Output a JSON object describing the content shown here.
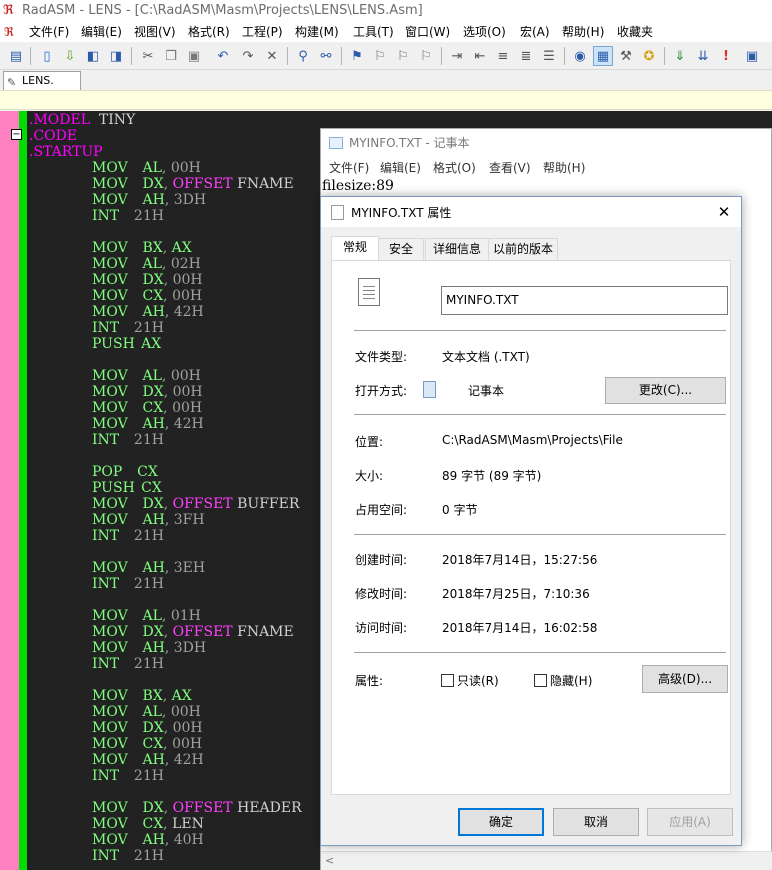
{
  "app": {
    "title": "RadASM - LENS - [C:\\RadASM\\Masm\\Projects\\LENS\\LENS.Asm]",
    "menu": [
      "文件(F)",
      "编辑(E)",
      "视图(V)",
      "格式(R)",
      "工程(P)",
      "构建(M)",
      "工具(T)",
      "窗口(W)",
      "选项(O)",
      "宏(A)",
      "帮助(H)",
      "收藏夹"
    ],
    "file_tab": "LENS. Asm"
  },
  "code": [
    [
      [
        "dir",
        ".MODEL "
      ],
      [
        "id",
        "TINY"
      ]
    ],
    [
      [
        "dir",
        ".CODE"
      ]
    ],
    [
      [
        "dir",
        ".STARTUP"
      ]
    ],
    [
      [
        "kw",
        "MOV"
      ],
      [
        "reg",
        "AL"
      ],
      [
        "pun",
        ","
      ],
      [
        "num",
        "00H"
      ]
    ],
    [
      [
        "kw",
        "MOV"
      ],
      [
        "reg",
        "DX"
      ],
      [
        "pun",
        ","
      ],
      [
        "off",
        "OFFSET"
      ],
      [
        "id",
        "FNAME"
      ]
    ],
    [
      [
        "kw",
        "MOV"
      ],
      [
        "reg",
        "AH"
      ],
      [
        "pun",
        ","
      ],
      [
        "num",
        "3DH"
      ]
    ],
    [
      [
        "kw",
        "INT"
      ],
      [
        "num",
        "21H"
      ]
    ],
    [],
    [
      [
        "kw",
        "MOV"
      ],
      [
        "reg",
        "BX"
      ],
      [
        "pun",
        ","
      ],
      [
        "reg",
        "AX"
      ]
    ],
    [
      [
        "kw",
        "MOV"
      ],
      [
        "reg",
        "AL"
      ],
      [
        "pun",
        ","
      ],
      [
        "num",
        "02H"
      ]
    ],
    [
      [
        "kw",
        "MOV"
      ],
      [
        "reg",
        "DX"
      ],
      [
        "pun",
        ","
      ],
      [
        "num",
        "00H"
      ]
    ],
    [
      [
        "kw",
        "MOV"
      ],
      [
        "reg",
        "CX"
      ],
      [
        "pun",
        ","
      ],
      [
        "num",
        "00H"
      ]
    ],
    [
      [
        "kw",
        "MOV"
      ],
      [
        "reg",
        "AH"
      ],
      [
        "pun",
        ","
      ],
      [
        "num",
        "42H"
      ]
    ],
    [
      [
        "kw",
        "INT"
      ],
      [
        "num",
        "21H"
      ]
    ],
    [
      [
        "kw",
        "PUSH"
      ],
      [
        "reg",
        "AX"
      ]
    ],
    [],
    [
      [
        "kw",
        "MOV"
      ],
      [
        "reg",
        "AL"
      ],
      [
        "pun",
        ","
      ],
      [
        "num",
        "00H"
      ]
    ],
    [
      [
        "kw",
        "MOV"
      ],
      [
        "reg",
        "DX"
      ],
      [
        "pun",
        ","
      ],
      [
        "num",
        "00H"
      ]
    ],
    [
      [
        "kw",
        "MOV"
      ],
      [
        "reg",
        "CX"
      ],
      [
        "pun",
        ","
      ],
      [
        "num",
        "00H"
      ]
    ],
    [
      [
        "kw",
        "MOV"
      ],
      [
        "reg",
        "AH"
      ],
      [
        "pun",
        ","
      ],
      [
        "num",
        "42H"
      ]
    ],
    [
      [
        "kw",
        "INT"
      ],
      [
        "num",
        "21H"
      ]
    ],
    [],
    [
      [
        "kw",
        "POP"
      ],
      [
        "reg",
        "CX"
      ]
    ],
    [
      [
        "kw",
        "PUSH"
      ],
      [
        "reg",
        "CX"
      ]
    ],
    [
      [
        "kw",
        "MOV"
      ],
      [
        "reg",
        "DX"
      ],
      [
        "pun",
        ","
      ],
      [
        "off",
        "OFFSET"
      ],
      [
        "id",
        "BUFFER"
      ]
    ],
    [
      [
        "kw",
        "MOV"
      ],
      [
        "reg",
        "AH"
      ],
      [
        "pun",
        ","
      ],
      [
        "num",
        "3FH"
      ]
    ],
    [
      [
        "kw",
        "INT"
      ],
      [
        "num",
        "21H"
      ]
    ],
    [],
    [
      [
        "kw",
        "MOV"
      ],
      [
        "reg",
        "AH"
      ],
      [
        "pun",
        ","
      ],
      [
        "num",
        "3EH"
      ]
    ],
    [
      [
        "kw",
        "INT"
      ],
      [
        "num",
        "21H"
      ]
    ],
    [],
    [
      [
        "kw",
        "MOV"
      ],
      [
        "reg",
        "AL"
      ],
      [
        "pun",
        ","
      ],
      [
        "num",
        "01H"
      ]
    ],
    [
      [
        "kw",
        "MOV"
      ],
      [
        "reg",
        "DX"
      ],
      [
        "pun",
        ","
      ],
      [
        "off",
        "OFFSET"
      ],
      [
        "id",
        "FNAME"
      ]
    ],
    [
      [
        "kw",
        "MOV"
      ],
      [
        "reg",
        "AH"
      ],
      [
        "pun",
        ","
      ],
      [
        "num",
        "3DH"
      ]
    ],
    [
      [
        "kw",
        "INT"
      ],
      [
        "num",
        "21H"
      ]
    ],
    [],
    [
      [
        "kw",
        "MOV"
      ],
      [
        "reg",
        "BX"
      ],
      [
        "pun",
        ","
      ],
      [
        "reg",
        "AX"
      ]
    ],
    [
      [
        "kw",
        "MOV"
      ],
      [
        "reg",
        "AL"
      ],
      [
        "pun",
        ","
      ],
      [
        "num",
        "00H"
      ]
    ],
    [
      [
        "kw",
        "MOV"
      ],
      [
        "reg",
        "DX"
      ],
      [
        "pun",
        ","
      ],
      [
        "num",
        "00H"
      ]
    ],
    [
      [
        "kw",
        "MOV"
      ],
      [
        "reg",
        "CX"
      ],
      [
        "pun",
        ","
      ],
      [
        "num",
        "00H"
      ]
    ],
    [
      [
        "kw",
        "MOV"
      ],
      [
        "reg",
        "AH"
      ],
      [
        "pun",
        ","
      ],
      [
        "num",
        "42H"
      ]
    ],
    [
      [
        "kw",
        "INT"
      ],
      [
        "num",
        "21H"
      ]
    ],
    [],
    [
      [
        "kw",
        "MOV"
      ],
      [
        "reg",
        "DX"
      ],
      [
        "pun",
        ","
      ],
      [
        "off",
        "OFFSET"
      ],
      [
        "id",
        "HEADER"
      ]
    ],
    [
      [
        "kw",
        "MOV"
      ],
      [
        "reg",
        "CX"
      ],
      [
        "pun",
        ","
      ],
      [
        "id",
        "LEN"
      ]
    ],
    [
      [
        "kw",
        "MOV"
      ],
      [
        "reg",
        "AH"
      ],
      [
        "pun",
        ","
      ],
      [
        "num",
        "40H"
      ]
    ],
    [
      [
        "kw",
        "INT"
      ],
      [
        "num",
        "21H"
      ]
    ]
  ],
  "notepad": {
    "title": "MYINFO.TXT - 记事本",
    "menu": [
      "文件(F)",
      "编辑(E)",
      "格式(O)",
      "查看(V)",
      "帮助(H)"
    ],
    "text": "filesize:89",
    "scroll_left": "<"
  },
  "dialog": {
    "title": "MYINFO.TXT 属性",
    "close": "✕",
    "tabs": [
      "常规",
      "安全",
      "详细信息",
      "以前的版本"
    ],
    "file_name": "MYINFO.TXT",
    "type_label": "文件类型:",
    "type_value": "文本文档 (.TXT)",
    "open_label": "打开方式:",
    "open_value": "记事本",
    "change_button": "更改(C)...",
    "location_label": "位置:",
    "location_value": "C:\\RadASM\\Masm\\Projects\\File",
    "size_label": "大小:",
    "size_value": "89 字节 (89 字节)",
    "disk_label": "占用空间:",
    "disk_value": "0 字节",
    "created_label": "创建时间:",
    "created_value": "2018年7月14日，15:27:56",
    "modified_label": "修改时间:",
    "modified_value": "2018年7月25日，7:10:36",
    "accessed_label": "访问时间:",
    "accessed_value": "2018年7月14日，16:02:58",
    "attr_label": "属性:",
    "readonly_label": "只读(R)",
    "hidden_label": "隐藏(H)",
    "advanced_button": "高级(D)...",
    "ok_button": "确定",
    "cancel_button": "取消",
    "apply_button": "应用(A)"
  },
  "colors": {
    "editor_bg": "#222222",
    "directive": "#ff00ff",
    "keyword": "#80ff80",
    "number": "#a0a0a0",
    "gutter_pink": "#ff80c0",
    "gutter_green": "#00dd00",
    "accent": "#0078d7"
  }
}
